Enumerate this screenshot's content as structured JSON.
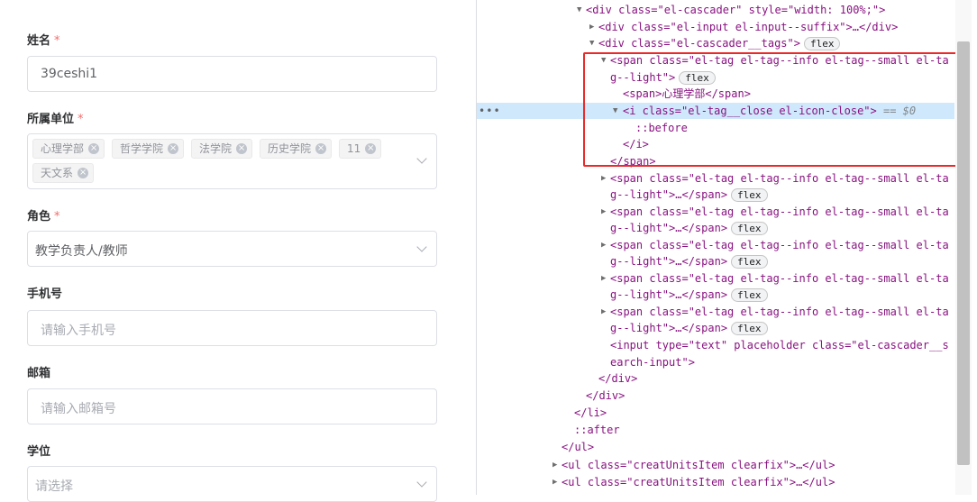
{
  "form": {
    "name_label": "姓名",
    "name_value": "39ceshi1",
    "unit_label": "所属单位",
    "unit_tags": [
      "心理学部",
      "哲学学院",
      "法学院",
      "历史学院",
      "11",
      "天文系"
    ],
    "role_label": "角色",
    "role_value": "教学负责人/教师",
    "phone_label": "手机号",
    "phone_placeholder": "请输入手机号",
    "email_label": "邮箱",
    "email_placeholder": "请输入邮箱号",
    "degree_label": "学位",
    "degree_placeholder": "请选择",
    "required_mark": "*",
    "tag_close": "×"
  },
  "devtools": {
    "badge": "flex",
    "eq_text": "== $0",
    "dots": "•••",
    "lines": [
      "<div class=\"el-cascader\" style=\"width: 100%;\">",
      "<div class=\"el-input el-input--suffix\">…</div>",
      "<div class=\"el-cascader__tags\">",
      "<span class=\"el-tag el-tag--info el-tag--small el-ta",
      "g--light\">",
      "<span>心理学部</span>",
      "<i class=\"el-tag__close el-icon-close\">",
      "::before",
      "</i>",
      "</span>",
      "<span class=\"el-tag el-tag--info el-tag--small el-ta",
      "g--light\">…</span>",
      "<input type=\"text\" placeholder class=\"el-cascader__s",
      "earch-input\">",
      "</div>",
      "</div>",
      "</li>",
      "::after",
      "</ul>",
      "<ul class=\"creatUnitsItem clearfix\">…</ul>",
      "<ul class=\"creatUnitsItem clearfix\">…</ul>"
    ]
  },
  "colors": {
    "required": "#f56c6c",
    "highlight_row": "#cfe8fc",
    "red_box": "#ea2a2a",
    "tag_name": "#881280",
    "attr_name": "#994500",
    "attr_value": "#1a1aa6"
  }
}
